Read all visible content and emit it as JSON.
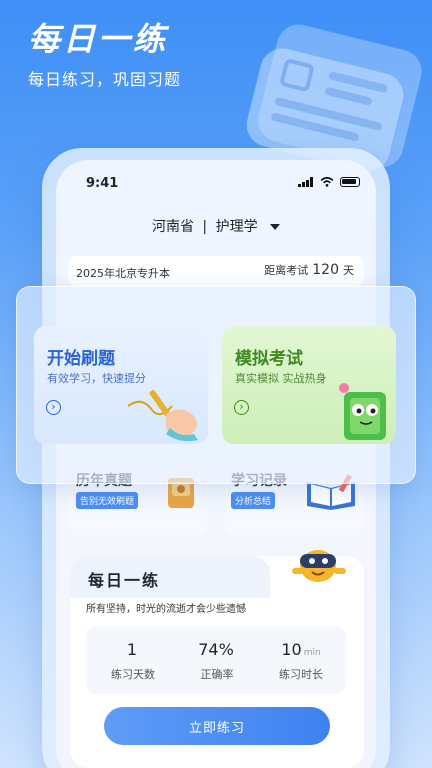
{
  "header": {
    "title": "每日一练",
    "subtitle": "每日练习，巩固习题"
  },
  "status_bar": {
    "time": "9:41"
  },
  "selector": {
    "province": "河南省",
    "separator": "|",
    "major": "护理学"
  },
  "exam_bar": {
    "exam_name": "2025年北京专升本",
    "countdown_label": "距离考试",
    "countdown_value": "120",
    "countdown_unit": "天"
  },
  "features": [
    {
      "title": "开始刷题",
      "subtitle": "有效学习，快速提分"
    },
    {
      "title": "模拟考试",
      "subtitle": "真实模拟 实战热身"
    }
  ],
  "secondary_features": [
    {
      "title": "历年真题",
      "tag": "告别无效刷题"
    },
    {
      "title": "学习记录",
      "tag": "分析总结"
    }
  ],
  "daily": {
    "title": "每日一练",
    "slogan": "所有坚持，时光的流逝才会少些遗憾",
    "stats": [
      {
        "value": "1",
        "unit": "",
        "label": "练习天数"
      },
      {
        "value": "74%",
        "unit": "",
        "label": "正确率"
      },
      {
        "value": "10",
        "unit": "min",
        "label": "练习时长"
      }
    ],
    "cta": "立即练习"
  },
  "colors": {
    "accent": "#3e82f2",
    "green": "#3f8a1f",
    "bg_top": "#3f8ff7"
  },
  "icons": [
    "document-icon",
    "signal-icon",
    "wifi-icon",
    "battery-icon",
    "arrow-right-circle-icon",
    "hand-pen-icon",
    "book-mascot-icon",
    "mascot-icon"
  ]
}
